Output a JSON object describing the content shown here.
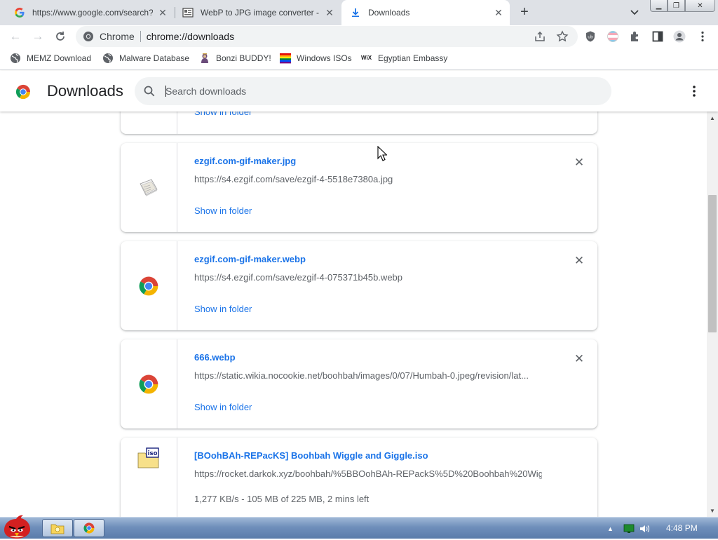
{
  "tabs": [
    {
      "title": "https://www.google.com/search?",
      "active": false,
      "favicon": "google-g-icon"
    },
    {
      "title": "WebP to JPG image converter - ",
      "active": false,
      "favicon": "ezgif-page-icon"
    },
    {
      "title": "Downloads",
      "active": true,
      "favicon": "download-arrow-icon"
    }
  ],
  "omnibox": {
    "scheme_label": "Chrome",
    "url": "chrome://downloads"
  },
  "bookmarks": [
    {
      "label": "MEMZ Download",
      "icon": "globe-icon"
    },
    {
      "label": "Malware Database",
      "icon": "globe-icon"
    },
    {
      "label": "Bonzi BUDDY!",
      "icon": "bonzi-icon"
    },
    {
      "label": "Windows ISOs",
      "icon": "windows-flag-icon"
    },
    {
      "label": "Egyptian Embassy",
      "icon": "wix-icon"
    }
  ],
  "downloads_page": {
    "title": "Downloads",
    "search_placeholder": "Search downloads"
  },
  "downloads": [
    {
      "name": "",
      "url": "",
      "action": "Show in folder",
      "icon": "generic-file-icon"
    },
    {
      "name": "ezgif.com-gif-maker.jpg",
      "url": "https://s4.ezgif.com/save/ezgif-4-5518e7380a.jpg",
      "action": "Show in folder",
      "icon": "image-file-icon"
    },
    {
      "name": "ezgif.com-gif-maker.webp",
      "url": "https://s4.ezgif.com/save/ezgif-4-075371b45b.webp",
      "action": "Show in folder",
      "icon": "chrome-icon"
    },
    {
      "name": "666.webp",
      "url": "https://static.wikia.nocookie.net/boohbah/images/0/07/Humbah-0.jpeg/revision/lat...",
      "action": "Show in folder",
      "icon": "chrome-icon"
    },
    {
      "name": "[BOohBAh-REPacKS] Boohbah Wiggle and Giggle.iso",
      "url": "https://rocket.darkok.xyz/boohbah/%5BBOohBAh-REPackS%5D%20Boohbah%20Wig...",
      "status": "1,277 KB/s - 105 MB of 225 MB, 2 mins left",
      "icon": "iso-file-icon"
    }
  ],
  "taskbar": {
    "clock": "4:48 PM"
  },
  "colors": {
    "link_blue": "#1a73e8",
    "tabbar_bg": "#dee1e6",
    "omnibox_bg": "#f1f3f4"
  }
}
